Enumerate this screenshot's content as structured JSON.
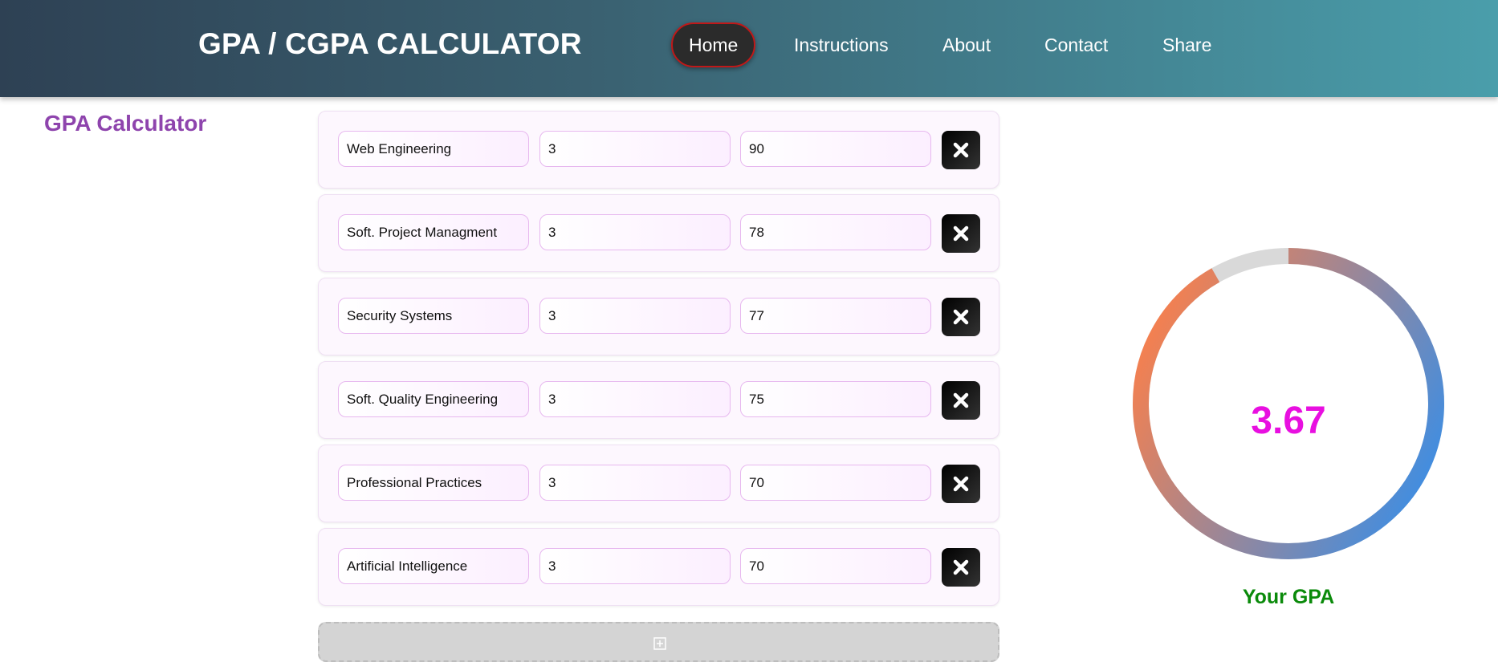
{
  "header": {
    "brand": "GPA / CGPA CALCULATOR",
    "nav": [
      {
        "label": "Home",
        "active": true
      },
      {
        "label": "Instructions"
      },
      {
        "label": "About"
      },
      {
        "label": "Contact"
      },
      {
        "label": "Share"
      }
    ]
  },
  "page_title": "GPA Calculator",
  "courses": [
    {
      "name": "Web Engineering",
      "credits": "3",
      "marks": "90"
    },
    {
      "name": "Soft. Project Managment",
      "credits": "3",
      "marks": "78"
    },
    {
      "name": "Security Systems",
      "credits": "3",
      "marks": "77"
    },
    {
      "name": "Soft. Quality Engineering",
      "credits": "3",
      "marks": "75"
    },
    {
      "name": "Professional Practices",
      "credits": "3",
      "marks": "70"
    },
    {
      "name": "Artificial Intelligence",
      "credits": "3",
      "marks": "70"
    }
  ],
  "icons": {
    "remove": "close-icon",
    "add": "plus-icon"
  },
  "result": {
    "gpa": "3.67",
    "label": "Your GPA",
    "scale_max": 4.0,
    "colors": {
      "value": "#e80fe0",
      "label": "#0a8a0a",
      "ring_start": "#f5804f",
      "ring_end": "#3a8ee6",
      "ring_track": "#d9d9d9"
    }
  }
}
